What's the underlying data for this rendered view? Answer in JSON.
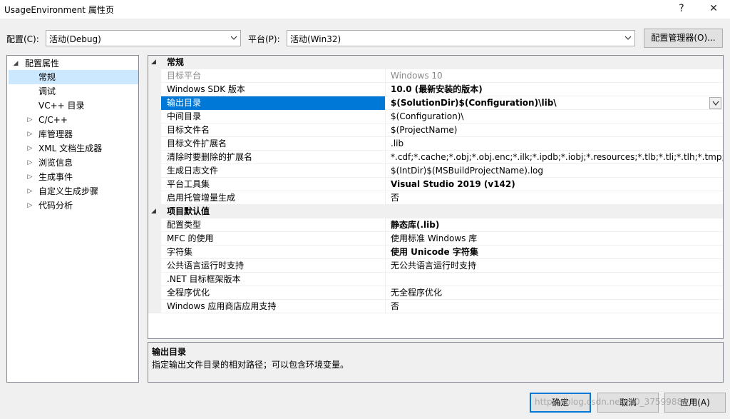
{
  "window": {
    "title": "UsageEnvironment 属性页",
    "help_glyph": "?",
    "close_glyph": "✕"
  },
  "toolbar": {
    "config_label": "配置(C):",
    "config_value": "活动(Debug)",
    "platform_label": "平台(P):",
    "platform_value": "活动(Win32)",
    "config_manager_label": "配置管理器(O)..."
  },
  "tree": {
    "items": [
      {
        "label": "配置属性",
        "expander": "◢"
      },
      {
        "label": "常规",
        "expander": ""
      },
      {
        "label": "调试",
        "expander": ""
      },
      {
        "label": "VC++ 目录",
        "expander": ""
      },
      {
        "label": "C/C++",
        "expander": "▷"
      },
      {
        "label": "库管理器",
        "expander": "▷"
      },
      {
        "label": "XML 文档生成器",
        "expander": "▷"
      },
      {
        "label": "浏览信息",
        "expander": "▷"
      },
      {
        "label": "生成事件",
        "expander": "▷"
      },
      {
        "label": "自定义生成步骤",
        "expander": "▷"
      },
      {
        "label": "代码分析",
        "expander": "▷"
      }
    ]
  },
  "grid": {
    "categories": [
      {
        "label": "常规",
        "expander": "◢",
        "rows": [
          {
            "name": "目标平台",
            "value": "Windows 10"
          },
          {
            "name": "Windows SDK 版本",
            "value": "10.0 (最新安装的版本)"
          },
          {
            "name": "输出目录",
            "value": "$(SolutionDir)$(Configuration)\\lib\\"
          },
          {
            "name": "中间目录",
            "value": "$(Configuration)\\"
          },
          {
            "name": "目标文件名",
            "value": "$(ProjectName)"
          },
          {
            "name": "目标文件扩展名",
            "value": ".lib"
          },
          {
            "name": "清除时要删除的扩展名",
            "value": "*.cdf;*.cache;*.obj;*.obj.enc;*.ilk;*.ipdb;*.iobj;*.resources;*.tlb;*.tli;*.tlh;*.tmp;*.rsp;*.pgc;*.pgd"
          },
          {
            "name": "生成日志文件",
            "value": "$(IntDir)$(MSBuildProjectName).log"
          },
          {
            "name": "平台工具集",
            "value": "Visual Studio 2019 (v142)"
          },
          {
            "name": "启用托管增量生成",
            "value": "否"
          }
        ]
      },
      {
        "label": "项目默认值",
        "expander": "◢",
        "rows": [
          {
            "name": "配置类型",
            "value": "静态库(.lib)"
          },
          {
            "name": "MFC 的使用",
            "value": "使用标准 Windows 库"
          },
          {
            "name": "字符集",
            "value": "使用 Unicode 字符集"
          },
          {
            "name": "公共语言运行时支持",
            "value": "无公共语言运行时支持"
          },
          {
            "name": ".NET 目标框架版本",
            "value": ""
          },
          {
            "name": "全程序优化",
            "value": "无全程序优化"
          },
          {
            "name": "Windows 应用商店应用支持",
            "value": "否"
          }
        ]
      }
    ]
  },
  "description": {
    "title": "输出目录",
    "text": "指定输出文件目录的相对路径；可以包含环境变量。"
  },
  "buttons": {
    "ok": "确定",
    "cancel": "取消",
    "apply": "应用(A)"
  },
  "watermark": "https://blog.csdn.net/m0_37599884"
}
